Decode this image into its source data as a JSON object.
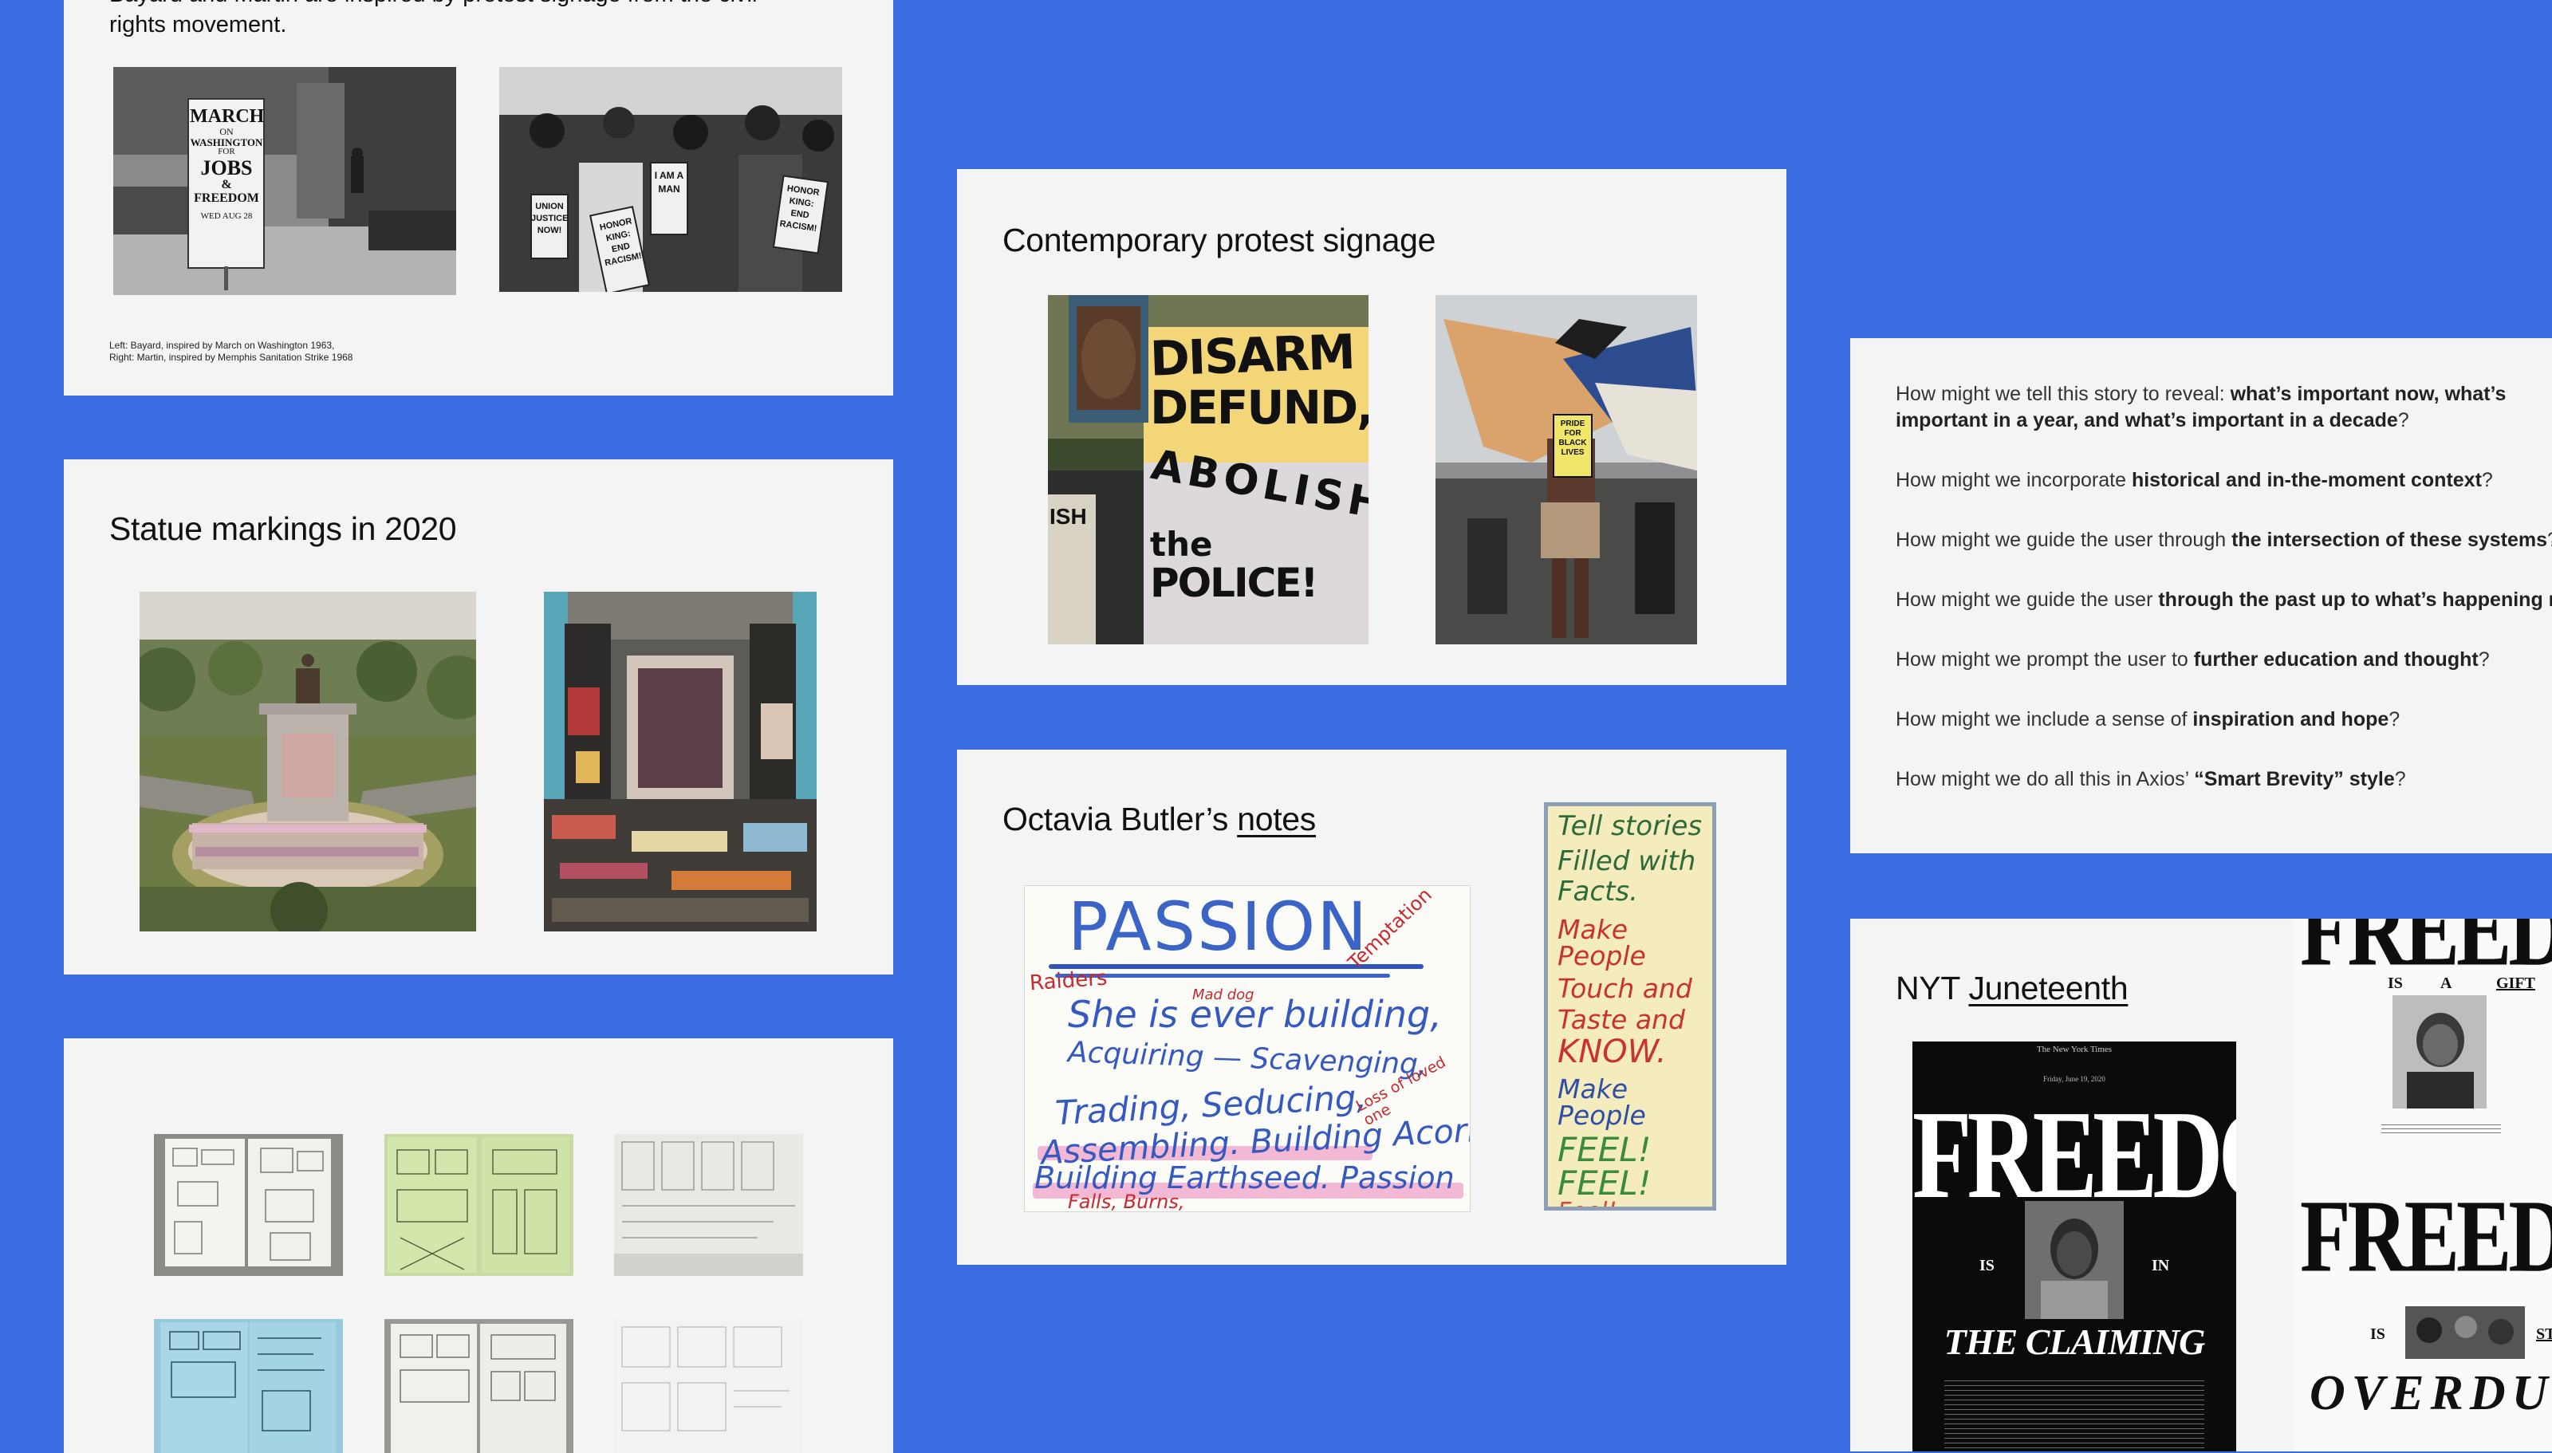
{
  "cards": {
    "civil_rights": {
      "intro": "Bayard and Martin are inspired by protest signage from the civil rights movement.",
      "photo_left_sign": [
        "MARCH",
        "ON",
        "WASHINGTON",
        "FOR",
        "JOBS",
        "& FREEDOM",
        "WED AUG 28"
      ],
      "photo_right_signs": [
        "UNION JUSTICE NOW!",
        "HONOR KING: END RACISM!",
        "I AM A MAN",
        "HONOR KING: END RACISM!"
      ],
      "caption_line1": "Left: Bayard, inspired by March on Washington 1963,",
      "caption_line2": "Right: Martin, inspired by Memphis Sanitation Strike 1968"
    },
    "statue": {
      "title": "Statue markings in 2020"
    },
    "sketches": {
      "count": 6
    },
    "protest": {
      "title": "Contemporary protest signage",
      "sign_lines": [
        "DISARM",
        "DEFUND,",
        "ABOLISH",
        "the",
        "POLICE!"
      ],
      "sign_side": "ISH",
      "small_sign": [
        "PRIDE",
        "FOR",
        "BLACK",
        "LIVES"
      ]
    },
    "butler": {
      "title_prefix": "Octavia Butler’s ",
      "title_link": "notes",
      "note1": {
        "headline": "PASSION",
        "raiders": "Raiders",
        "mad_dog": "Mad dog",
        "temptation": "Temptation",
        "line1": "She is ever building,",
        "line2": "Acquiring — Scavenging,",
        "line3": "Trading, Seducing,",
        "loss": "Loss of loved one",
        "line4": "Assembling. Building Acorn",
        "line5": "Building Earthseed. Passion",
        "line6": "Falls, Burns,"
      },
      "note2": [
        "Tell stories",
        "Filled with",
        "Facts.",
        "Make People",
        "Touch and",
        "Taste and",
        "KNOW.",
        "Make People",
        "FEEL!",
        "FEEL!",
        "Feel!"
      ]
    },
    "hmw": {
      "items": [
        {
          "pre": "How might we tell this story to reveal: ",
          "bold": "what’s important now, what’s important in a year, and what’s important in a decade",
          "post": "?"
        },
        {
          "pre": "How might we incorporate ",
          "bold": "historical and in-the-moment context",
          "post": "?"
        },
        {
          "pre": "How might we guide the user through ",
          "bold": "the intersection of these systems",
          "post": "?"
        },
        {
          "pre": "How might we guide the user ",
          "bold": "through the past up to what’s happening now",
          "post": "?"
        },
        {
          "pre": "How might we prompt the user to ",
          "bold": "further education and thought",
          "post": "?"
        },
        {
          "pre": "How might we include a sense of ",
          "bold": "inspiration and hope",
          "post": "?"
        },
        {
          "pre": "How might we do all this in Axios’ ",
          "bold": "“Smart Brevity” style",
          "post": "?"
        }
      ]
    },
    "nyt": {
      "title_prefix": "NYT ",
      "title_link": "Juneteenth",
      "cover": {
        "masthead": "The New York Times",
        "date": "Friday, June 19, 2020",
        "headline": "FREEDOM",
        "is": "IS",
        "in": "IN",
        "claiming": "THE CLAIMING"
      },
      "spread": {
        "headline_top": "FREEDOM",
        "is": "IS",
        "a": "A",
        "gift": "GIFT",
        "headline_mid": "FREEDOM",
        "is2": "IS",
        "still": "STILL",
        "overdue": "OVERDUE"
      }
    }
  }
}
